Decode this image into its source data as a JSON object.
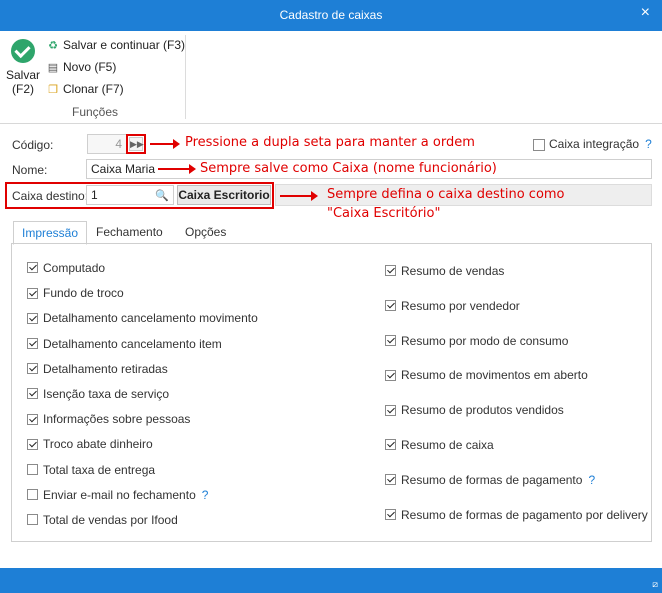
{
  "window": {
    "title": "Cadastro de caixas",
    "close_icon": "×"
  },
  "ribbon": {
    "save_label_1": "Salvar",
    "save_label_2": "(F2)",
    "items": [
      {
        "label": "Salvar e continuar (F3)",
        "icon": "save-continue-icon"
      },
      {
        "label": "Novo (F5)",
        "icon": "new-document-icon"
      },
      {
        "label": "Clonar (F7)",
        "icon": "clone-icon"
      }
    ],
    "group_label": "Funções"
  },
  "form": {
    "codigo_label": "Código:",
    "codigo_value": "4",
    "caixa_integracao_label": "Caixa integração",
    "caixa_integracao_checked": false,
    "help_mark": "?",
    "nome_label": "Nome:",
    "nome_value": "Caixa Maria",
    "destino_label": "Caixa destino:",
    "destino_value": "1",
    "destino_button": "Caixa Escritorio"
  },
  "annotations": {
    "a1": "Pressione a dupla seta para manter a ordem",
    "a2": "Sempre salve como Caixa (nome funcionário)",
    "a3_line1": "Sempre defina o caixa destino como",
    "a3_line2": "\"Caixa Escritório\""
  },
  "tabs": [
    {
      "label": "Impressão",
      "active": true
    },
    {
      "label": "Fechamento",
      "active": false
    },
    {
      "label": "Opções",
      "active": false
    }
  ],
  "left_options": [
    {
      "label": "Computado",
      "checked": true
    },
    {
      "label": "Fundo de troco",
      "checked": true
    },
    {
      "label": "Detalhamento cancelamento movimento",
      "checked": true
    },
    {
      "label": "Detalhamento cancelamento item",
      "checked": true
    },
    {
      "label": "Detalhamento retiradas",
      "checked": true
    },
    {
      "label": "Isenção taxa de serviço",
      "checked": true
    },
    {
      "label": "Informações sobre pessoas",
      "checked": true
    },
    {
      "label": "Troco abate dinheiro",
      "checked": true
    },
    {
      "label": "Total taxa de entrega",
      "checked": false
    },
    {
      "label": "Enviar e-mail no fechamento",
      "checked": false,
      "help": "?"
    },
    {
      "label": "Total de vendas por Ifood",
      "checked": false
    }
  ],
  "right_options": [
    {
      "label": "Resumo de vendas",
      "checked": true
    },
    {
      "label": "Resumo por vendedor",
      "checked": true
    },
    {
      "label": "Resumo por modo de consumo",
      "checked": true
    },
    {
      "label": "Resumo de movimentos em aberto",
      "checked": true
    },
    {
      "label": "Resumo de produtos vendidos",
      "checked": true
    },
    {
      "label": "Resumo de caixa",
      "checked": true
    },
    {
      "label": "Resumo de formas de pagamento",
      "checked": true,
      "help": "?"
    },
    {
      "label": "Resumo de formas de pagamento por delivery",
      "checked": true
    }
  ]
}
